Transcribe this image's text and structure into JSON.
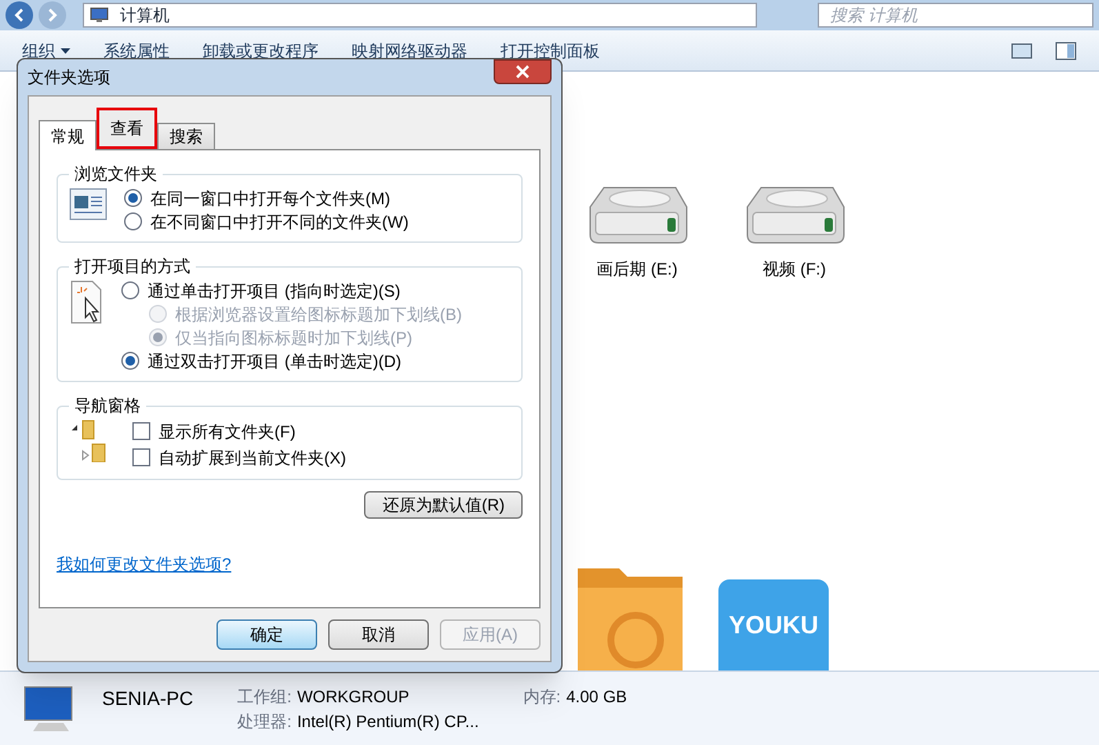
{
  "explorer": {
    "breadcrumb": "计算机",
    "search": {
      "placeholder": "搜索 计算机"
    },
    "toolbar": [
      {
        "label": "组织",
        "dropdown": true
      },
      {
        "label": "系统属性",
        "dropdown": false
      },
      {
        "label": "卸载或更改程序",
        "dropdown": false
      },
      {
        "label": "映射网络驱动器",
        "dropdown": false
      },
      {
        "label": "打开控制面板",
        "dropdown": false
      }
    ],
    "drives": [
      {
        "label": "画后期 (E:)"
      },
      {
        "label": "视频 (F:)"
      }
    ],
    "folders": [
      {
        "kind": "orange"
      },
      {
        "kind": "youku",
        "label": "YOUKU"
      }
    ],
    "details": {
      "name": "SENIA-PC",
      "workgroup_label": "工作组:",
      "workgroup": "WORKGROUP",
      "memory_label": "内存:",
      "memory": "4.00 GB",
      "cpu_label": "处理器:",
      "cpu": "Intel(R) Pentium(R) CP..."
    }
  },
  "dialog": {
    "title": "文件夹选项",
    "tabs": [
      {
        "label": "常规",
        "selected": true,
        "highlighted": false
      },
      {
        "label": "查看",
        "selected": false,
        "highlighted": true
      },
      {
        "label": "搜索",
        "selected": false,
        "highlighted": false
      }
    ],
    "groups": [
      {
        "title": "浏览文件夹",
        "options": [
          {
            "kind": "radio",
            "label": "在同一窗口中打开每个文件夹(M)",
            "selected": true,
            "disabled": false
          },
          {
            "kind": "radio",
            "label": "在不同窗口中打开不同的文件夹(W)",
            "selected": false,
            "disabled": false
          }
        ]
      },
      {
        "title": "打开项目的方式",
        "options": [
          {
            "kind": "radio",
            "label": "通过单击打开项目 (指向时选定)(S)",
            "selected": false,
            "disabled": false,
            "children": [
              {
                "kind": "radio",
                "label": "根据浏览器设置给图标标题加下划线(B)",
                "selected": false,
                "disabled": true
              },
              {
                "kind": "radio",
                "label": "仅当指向图标标题时加下划线(P)",
                "selected": true,
                "disabled": true
              }
            ]
          },
          {
            "kind": "radio",
            "label": "通过双击打开项目 (单击时选定)(D)",
            "selected": true,
            "disabled": false
          }
        ]
      },
      {
        "title": "导航窗格",
        "options": [
          {
            "kind": "checkbox",
            "label": "显示所有文件夹(F)",
            "checked": false,
            "disabled": false
          },
          {
            "kind": "checkbox",
            "label": "自动扩展到当前文件夹(X)",
            "checked": false,
            "disabled": false
          }
        ]
      }
    ],
    "restore_button": "还原为默认值(R)",
    "help_link": "我如何更改文件夹选项?",
    "buttons": [
      {
        "label": "确定",
        "kind": "default",
        "disabled": false
      },
      {
        "label": "取消",
        "kind": "normal",
        "disabled": false
      },
      {
        "label": "应用(A)",
        "kind": "normal",
        "disabled": true
      }
    ]
  }
}
